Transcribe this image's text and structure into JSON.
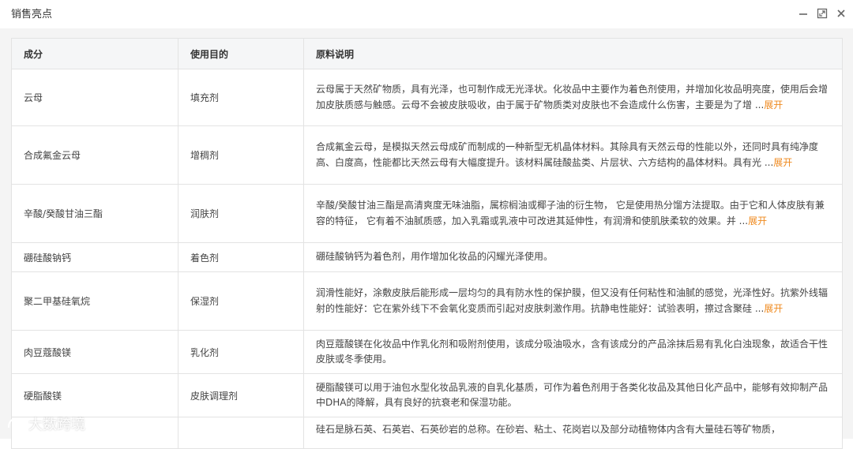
{
  "window": {
    "title": "销售亮点",
    "icons": {
      "minimize": "minimize-icon",
      "maximize": "maximize-icon",
      "close": "close-icon"
    }
  },
  "table": {
    "headers": [
      "成分",
      "使用目的",
      "原料说明"
    ],
    "rows": [
      {
        "ingredient": "云母",
        "purpose": "填充剂",
        "description": "云母属于天然矿物质，具有光泽，也可制作成无光泽状。化妆品中主要作为着色剂使用，并增加化妆品明亮度，使用后会增加皮肤质感与触感。云母不会被皮肤吸收，由于属于矿物质类对皮肤也不会造成什么伤害，主要是为了增 ...",
        "expand": "展开"
      },
      {
        "ingredient": "合成氟金云母",
        "purpose": "增稠剂",
        "description": "合成氟金云母，是模拟天然云母成矿而制成的一种新型无机晶体材料。其除具有天然云母的性能以外，还同时具有纯净度高、白度高，性能都比天然云母有大幅度提升。该材料属硅酸盐类、片层状、六方结构的晶体材料。具有光 ...",
        "expand": "展开"
      },
      {
        "ingredient": "辛酸/癸酸甘油三酯",
        "purpose": "润肤剂",
        "description": "辛酸/癸酸甘油三酯是高清爽度无味油脂，属棕榈油或椰子油的衍生物， 它是使用热分馏方法提取。由于它和人体皮肤有兼容的特征， 它有着不油腻质感，加入乳霜或乳液中可改进其延伸性，有润滑和使肌肤柔软的效果。并 ...",
        "expand": "展开"
      },
      {
        "ingredient": "硼硅酸钠钙",
        "purpose": "着色剂",
        "description": "硼硅酸钠钙为着色剂，用作增加化妆品的闪耀光泽使用。",
        "expand": ""
      },
      {
        "ingredient": "聚二甲基硅氧烷",
        "purpose": "保湿剂",
        "description": "润滑性能好，涂敷皮肤后能形成一层均匀的具有防水性的保护膜，但又没有任何粘性和油腻的感觉，光泽性好。抗紫外线辐射的性能好：它在紫外线下不会氧化变质而引起对皮肤刺激作用。抗静电性能好：试验表明，擦过含聚硅 ...",
        "expand": "展开"
      },
      {
        "ingredient": "肉豆蔻酸镁",
        "purpose": "乳化剂",
        "description": "肉豆蔻酸镁在化妆品中作乳化剂和吸附剂使用，该成分吸油吸水，含有该成分的产品涂抹后易有乳化白浊现象，故适合干性皮肤或冬季使用。",
        "expand": ""
      },
      {
        "ingredient": "硬脂酸镁",
        "purpose": "皮肤调理剂",
        "description": "硬脂酸镁可以用于油包水型化妆品乳液的自乳化基质，可作为着色剂用于各类化妆品及其他日化产品中，能够有效抑制产品中DHA的降解，具有良好的抗衰老和保湿功能。",
        "expand": ""
      },
      {
        "ingredient": "",
        "purpose": "",
        "description": "硅石是脉石英、石英岩、石英砂岩的总称。在砂岩、粘土、花岗岩以及部分动植物体内含有大量硅石等矿物质，",
        "expand": ""
      }
    ]
  },
  "watermark": {
    "text": "大数跨境"
  }
}
